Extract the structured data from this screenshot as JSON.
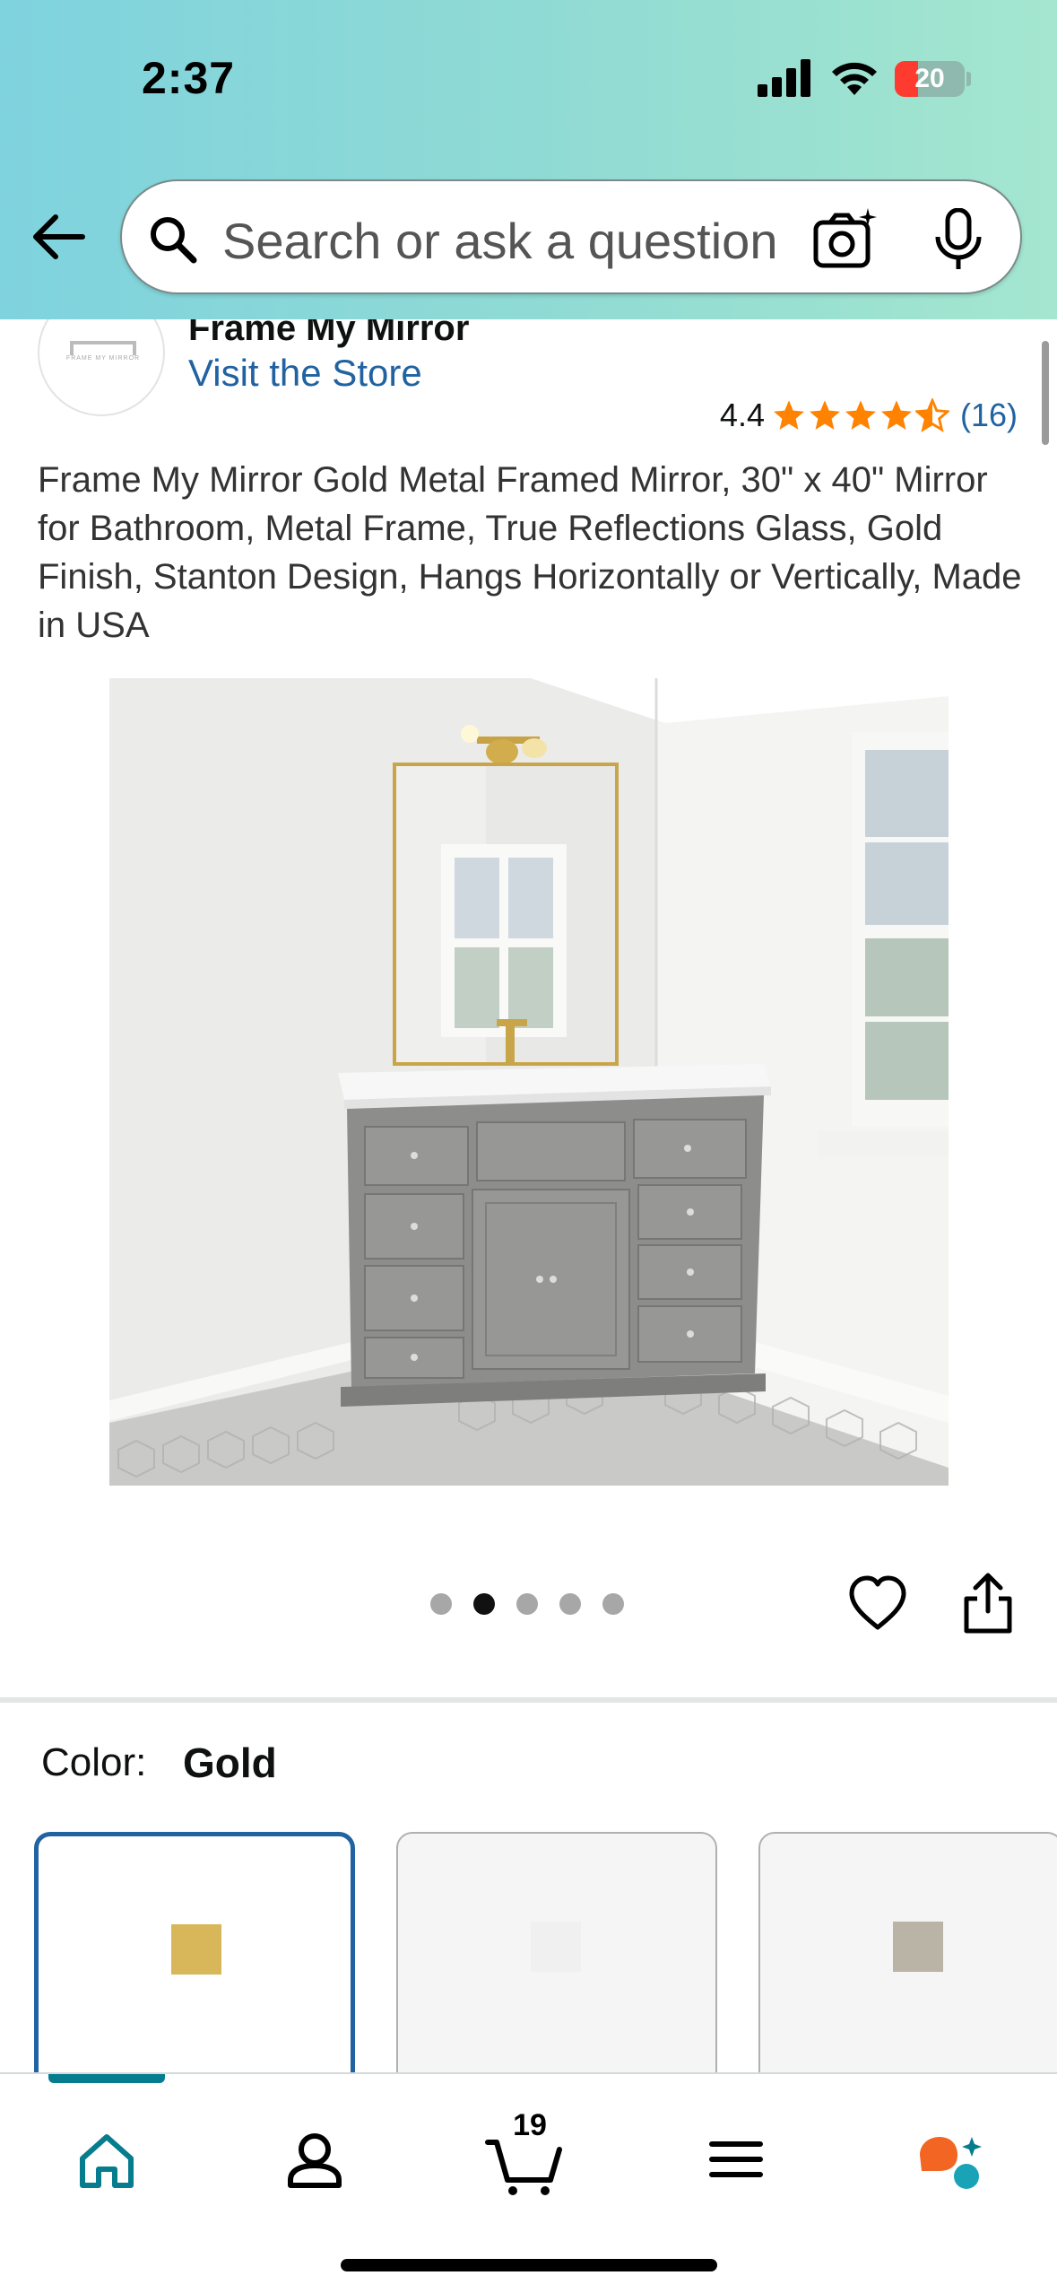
{
  "status_bar": {
    "time": "2:37",
    "battery_level": "20"
  },
  "search": {
    "placeholder": "Search or ask a question"
  },
  "brand": {
    "name": "Frame My Mirror",
    "visit_store": "Visit the Store",
    "logo_text": "FRAME MY MIRROR"
  },
  "rating": {
    "value": "4.4",
    "count": "(16)",
    "stars_filled": 4.4
  },
  "product": {
    "title": "Frame My Mirror Gold Metal Framed Mirror, 30\" x 40\" Mirror for Bathroom, Metal Frame, True Reflections Glass, Gold Finish, Stanton Design, Hangs Horizontally or Vertically, Made in USA",
    "image_count": 5,
    "active_image_index": 2
  },
  "color": {
    "label": "Color:",
    "selected": "Gold",
    "swatches": [
      {
        "color": "#d8b65a",
        "selected": true
      },
      {
        "color": "#f0f0f0",
        "selected": false
      },
      {
        "color": "#b9b4a5",
        "selected": false
      }
    ]
  },
  "bottom_nav": {
    "cart_count": "19",
    "items": [
      "home-icon",
      "account-icon",
      "cart-icon",
      "menu-icon",
      "rufus-icon"
    ]
  },
  "colors": {
    "link": "#2162a1",
    "star": "#ff8200",
    "accent": "#067d8f",
    "swatch_border_selected": "#2162a1"
  }
}
